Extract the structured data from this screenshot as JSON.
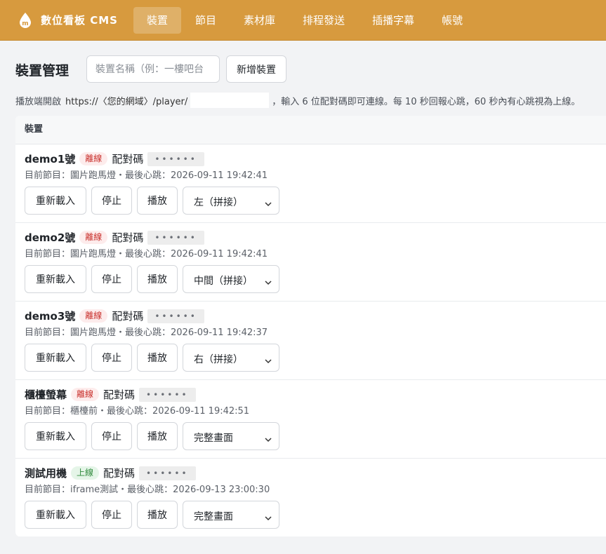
{
  "app": {
    "brand_name": "數位看板 CMS",
    "brand_color": "#d79a3e"
  },
  "nav": {
    "items": [
      {
        "label": "裝置",
        "active": true
      },
      {
        "label": "節目",
        "active": false
      },
      {
        "label": "素材庫",
        "active": false
      },
      {
        "label": "排程發送",
        "active": false
      },
      {
        "label": "插播字幕",
        "active": false
      },
      {
        "label": "帳號",
        "active": false
      }
    ]
  },
  "page": {
    "title": "裝置管理",
    "name_input_placeholder": "裝置名稱（例：一樓吧台",
    "add_button": "新增裝置",
    "hint_prefix": "播放端開啟",
    "hint_url": "https://〈您的網域〉/player/",
    "hint_suffix": "，輸入 6 位配對碼即可連線。每 10 秒回報心跳，60 秒內有心跳視為上線。"
  },
  "panel": {
    "header": "裝置"
  },
  "labels": {
    "pair_code": "配對碼",
    "reload": "重新載入",
    "stop": "停止",
    "play": "播放"
  },
  "devices": [
    {
      "name": "demo1號",
      "status": "離線",
      "status_type": "offline",
      "pair_code": "••••••",
      "meta": "目前節目：圖片跑馬燈・最後心跳：2026-09-11 19:42:41",
      "mode": "左（拼接）"
    },
    {
      "name": "demo2號",
      "status": "離線",
      "status_type": "offline",
      "pair_code": "••••••",
      "meta": "目前節目：圖片跑馬燈・最後心跳：2026-09-11 19:42:41",
      "mode": "中間（拼接）"
    },
    {
      "name": "demo3號",
      "status": "離線",
      "status_type": "offline",
      "pair_code": "••••••",
      "meta": "目前節目：圖片跑馬燈・最後心跳：2026-09-11 19:42:37",
      "mode": "右（拼接）"
    },
    {
      "name": "櫃檯螢幕",
      "status": "離線",
      "status_type": "offline",
      "pair_code": "••••••",
      "meta": "目前節目：櫃檯前・最後心跳：2026-09-11 19:42:51",
      "mode": "完整畫面"
    },
    {
      "name": "測試用機",
      "status": "上線",
      "status_type": "online",
      "pair_code": "••••••",
      "meta": "目前節目：iframe測試・最後心跳：2026-09-13 23:00:30",
      "mode": "完整畫面"
    }
  ]
}
